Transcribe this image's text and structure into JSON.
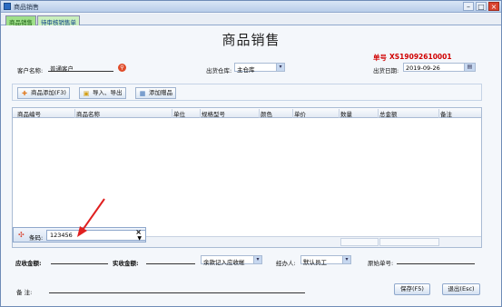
{
  "window": {
    "title": "商品销售"
  },
  "tabs": [
    {
      "label": "商品销售"
    },
    {
      "label": "待审核销售单"
    }
  ],
  "form": {
    "title": "商品销售",
    "order_no_label": "单号",
    "order_no": "XS19092610001",
    "customer_label": "客户名称:",
    "customer_value": "普通客户",
    "warehouse_label": "出货仓库:",
    "warehouse_value": "主仓库",
    "date_label": "出货日期:",
    "date_value": "2019-09-26"
  },
  "toolbar": {
    "add_product": "商品添加(F3)",
    "import_export": "导入、导出",
    "add_gift": "添加赠品"
  },
  "grid": {
    "columns": [
      "商品编号",
      "商品名称",
      "单位",
      "规格型号",
      "颜色",
      "单价",
      "数量",
      "总金额",
      "备注"
    ]
  },
  "barcode": {
    "label": "条码:",
    "value": "123456",
    "close": "×"
  },
  "bottom": {
    "receivable_label": "应收金额:",
    "received_label": "实收金额:",
    "balance_option": "余款记入应收帐",
    "handler_label": "经办人:",
    "handler_value": "默认员工",
    "original_no_label": "原始单号:",
    "remark_label": "备    注:",
    "save_button": "保存(F5)",
    "exit_button": "退出(Esc)"
  }
}
